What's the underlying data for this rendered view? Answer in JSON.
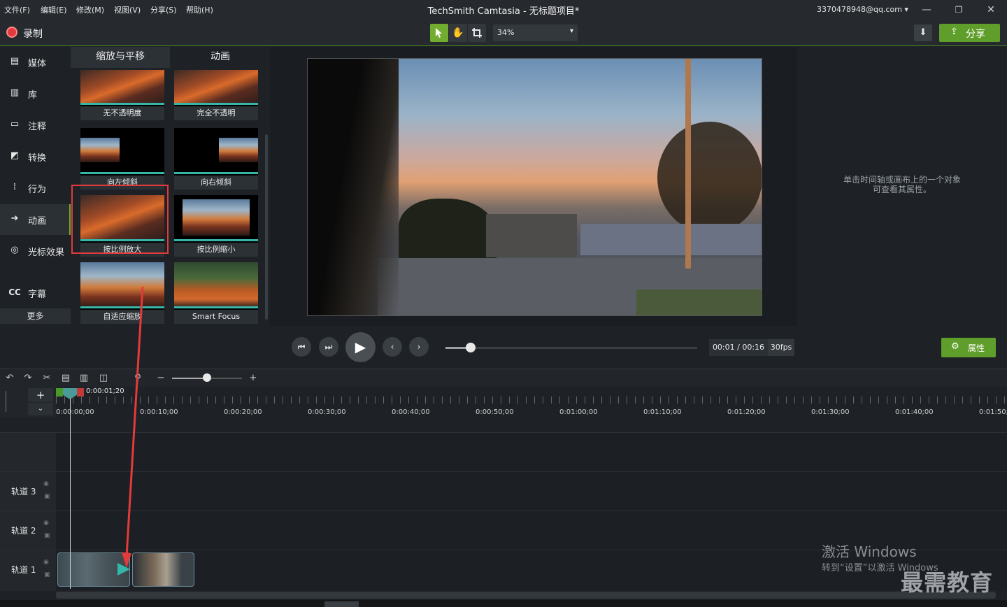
{
  "menu": {
    "items": [
      "文件(F)",
      "编辑(E)",
      "修改(M)",
      "视图(V)",
      "分享(S)",
      "帮助(H)"
    ]
  },
  "window": {
    "title": "TechSmith Camtasia - 无标题项目*",
    "account": "3370478948@qq.com ▾",
    "minimize": "—",
    "restore": "❐",
    "close": "✕"
  },
  "toolbar": {
    "record_label": "录制",
    "zoom_value": "34%",
    "share_label": "分享",
    "accent_color": "#5f9e2a",
    "record_color": "#e23a3a"
  },
  "sidebar": {
    "items": [
      {
        "label": "媒体",
        "icon": "media-icon"
      },
      {
        "label": "库",
        "icon": "library-icon"
      },
      {
        "label": "注释",
        "icon": "annotation-icon"
      },
      {
        "label": "转换",
        "icon": "transition-icon"
      },
      {
        "label": "行为",
        "icon": "behavior-icon"
      },
      {
        "label": "动画",
        "icon": "animation-icon"
      },
      {
        "label": "光标效果",
        "icon": "cursor-effect-icon"
      },
      {
        "label": "字幕",
        "icon": "captions-icon"
      }
    ],
    "active": "动画",
    "more_label": "更多"
  },
  "library": {
    "tabs": [
      "缩放与平移",
      "动画"
    ],
    "active_tab": "动画",
    "items": [
      {
        "label": "无不透明度"
      },
      {
        "label": "完全不透明"
      },
      {
        "label": "向左倾斜"
      },
      {
        "label": "向右倾斜"
      },
      {
        "label": "按比例放大",
        "highlighted": true
      },
      {
        "label": "按比例缩小"
      },
      {
        "label": "自适应缩放"
      },
      {
        "label": "Smart Focus"
      }
    ]
  },
  "properties_hint": {
    "line1": "单击时间轴或画布上的一个对象",
    "line2": "可查看其属性。"
  },
  "playback": {
    "timecode": "00:01 / 00:16",
    "fps": "30fps",
    "progress": 0.1,
    "properties_label": "属性"
  },
  "timeline": {
    "playhead_time": "0:00:01;20",
    "ruler_labels": [
      "0:00:00;00",
      "0:00:10;00",
      "0:00:20;00",
      "0:00:30;00",
      "0:00:40;00",
      "0:00:50;00",
      "0:01:00;00",
      "0:01:10;00",
      "0:01:20;00",
      "0:01:30;00",
      "0:01:40;00",
      "0:01:50;"
    ],
    "zoom_level": 0.5,
    "tracks": [
      {
        "name": "轨道 3"
      },
      {
        "name": "轨道 2"
      },
      {
        "name": "轨道 1"
      }
    ]
  },
  "overlay": {
    "activate_title": "激活 Windows",
    "activate_sub": "转到“设置”以激活 Windows",
    "watermark": "最需教育"
  }
}
